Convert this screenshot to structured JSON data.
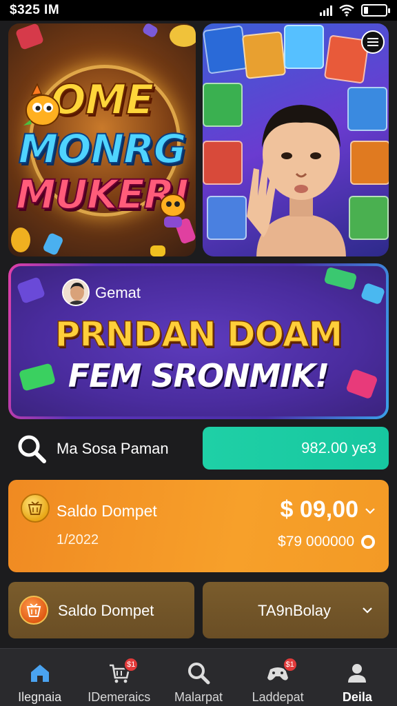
{
  "status_bar": {
    "time": "$325 IM",
    "battery_level": 0.2
  },
  "banners": {
    "left_logo": [
      "OME",
      "MONRG",
      "MUKERI"
    ],
    "promo_user": "Gemat",
    "promo_line1": "PRNDAN DOAM",
    "promo_line2": "FEM SRONMIK!"
  },
  "search": {
    "text": "Ma Sosa Paman",
    "balance_button": "982.00 ye3"
  },
  "wallet": {
    "title": "Saldo Dompet",
    "date": "1/2022",
    "amount": "$ 09,00",
    "sub_amount": "$79 000000"
  },
  "secondary": {
    "title": "Saldo Dompet",
    "selector": "TA9nBolay"
  },
  "bottom_nav": {
    "items": [
      {
        "label": "Ilegnaia",
        "icon": "home-icon"
      },
      {
        "label": "IDemeraics",
        "icon": "cart-icon",
        "badge": "$1"
      },
      {
        "label": "Malarpat",
        "icon": "search-icon"
      },
      {
        "label": "Laddepat",
        "icon": "gamepad-icon",
        "badge": "$1"
      },
      {
        "label": "Deila",
        "icon": "profile-icon"
      }
    ]
  },
  "colors": {
    "accent_green": "#1fd0a6",
    "wallet_orange": "#f39a25",
    "card_brown": "#6a4e25",
    "nav_active": "#4aa3f0"
  }
}
